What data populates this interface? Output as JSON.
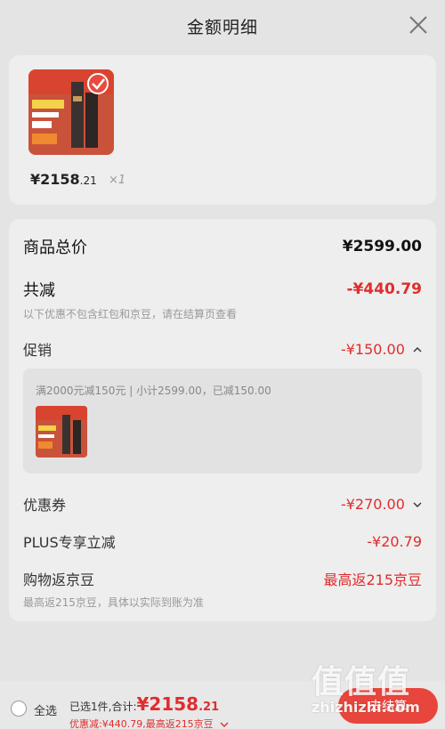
{
  "header": {
    "title": "金额明细"
  },
  "product": {
    "price_main": "¥2158",
    "price_dec": ".21",
    "qty": "×1"
  },
  "detail": {
    "total_label": "商品总价",
    "total_value": "¥2599.00",
    "saved_label": "共减",
    "saved_value": "-¥440.79",
    "saved_note": "以下优惠不包含红包和京豆，请在结算页查看",
    "promo_label": "促销",
    "promo_value": "-¥150.00",
    "promo_desc": "满2000元减150元 | 小计2599.00，已减150.00",
    "coupon_label": "优惠券",
    "coupon_value": "-¥270.00",
    "plus_label": "PLUS专享立减",
    "plus_value": "-¥20.79",
    "bean_label": "购物返京豆",
    "bean_value": "最高返215京豆",
    "bean_note": "最高返215京豆，具体以实际到账为准"
  },
  "bottom": {
    "select_all": "全选",
    "sum_prefix": "已选1件,合计:",
    "sum_main": "¥2158",
    "sum_dec": ".21",
    "discount_line": "优惠减:¥440.79,最高返215京豆",
    "checkout_label": "去结算"
  },
  "watermark": {
    "logo": "值值值",
    "url": "zhizhizhi.com"
  },
  "colors": {
    "accent": "#e02d2d",
    "checkout": "#e8453c"
  }
}
